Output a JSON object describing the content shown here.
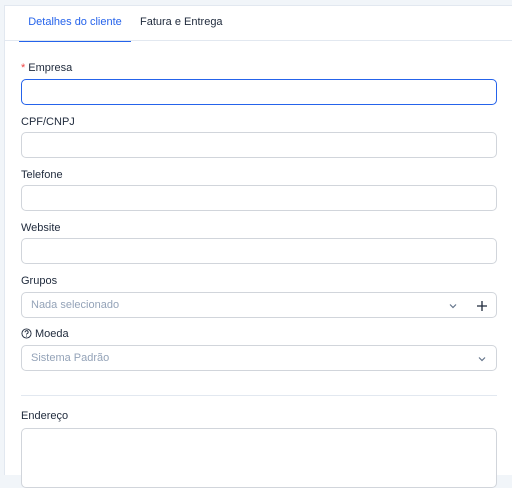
{
  "tabs": [
    {
      "label": "Detalhes do cliente",
      "active": true
    },
    {
      "label": "Fatura e Entrega",
      "active": false
    }
  ],
  "form": {
    "empresa": {
      "required_mark": "*",
      "label": "Empresa",
      "value": ""
    },
    "cpf_cnpj": {
      "label": "CPF/CNPJ",
      "value": ""
    },
    "telefone": {
      "label": "Telefone",
      "value": ""
    },
    "website": {
      "label": "Website",
      "value": ""
    },
    "grupos": {
      "label": "Grupos",
      "selected": "Nada selecionado",
      "add_icon": "plus-icon"
    },
    "moeda": {
      "label": "Moeda",
      "help_icon": "question-circle-icon",
      "selected": "Sistema Padrão"
    },
    "endereco": {
      "label": "Endereço",
      "value": ""
    }
  },
  "colors": {
    "accent": "#2563eb",
    "required": "#ef4444",
    "border": "#d1d5db",
    "placeholder": "#94a3b8"
  }
}
